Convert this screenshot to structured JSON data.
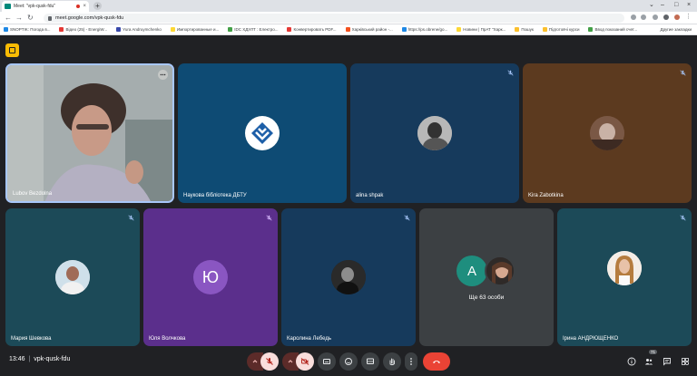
{
  "browser": {
    "tab_title": "Meet: \"vpk-qusk-fdu\"",
    "url": "meet.google.com/vpk-qusk-fdu",
    "bookmarks": [
      {
        "label": "SNOPTIK: Погода в...",
        "color": "#1e88e5"
      },
      {
        "label": "Відео (25) - EnergiW...",
        "color": "#e53935"
      },
      {
        "label": "Yura Andruymchenko",
        "color": "#3949ab"
      },
      {
        "label": "Импортированные и...",
        "color": "#fdd835"
      },
      {
        "label": "IDC ХДУЛТ : Електро...",
        "color": "#43a047"
      },
      {
        "label": "Конвертировать PDF...",
        "color": "#e53935"
      },
      {
        "label": "Харківський район -...",
        "color": "#f4511e"
      },
      {
        "label": "https://ps.obrene/go...",
        "color": "#1e88e5"
      },
      {
        "label": "Новини | ПрАТ \"Харк...",
        "color": "#fdd835"
      },
      {
        "label": "Пошук",
        "color": "#fbc02d"
      },
      {
        "label": "Підготовчі курси",
        "color": "#fbc02d"
      },
      {
        "label": "Ввод показаний счет...",
        "color": "#43a047"
      }
    ],
    "other_bookmarks": "Другие закладки"
  },
  "tiles": [
    {
      "name": "Lubov Bezdolna"
    },
    {
      "name": "Наукова бібліотека ДБТУ"
    },
    {
      "name": "alina shpak"
    },
    {
      "name": "Kira Zabotkina"
    },
    {
      "name": "Мария Шевкова"
    },
    {
      "name": "Юля Волчкова",
      "initial": "Ю"
    },
    {
      "name": "Каролина Лебедь"
    },
    {
      "name": "Ще 63 особи",
      "initial": "A"
    },
    {
      "name": "Ірина АНДРЮЩЕНКО"
    }
  ],
  "footer": {
    "time": "13:46",
    "separator": "|",
    "meeting_code": "vpk-qusk-fdu",
    "participant_count": "71"
  },
  "colors": {
    "end_call": "#ea4335",
    "muted_bg": "#f9dedc",
    "muted_icon": "#b3261e",
    "active_speaker_border": "#a8c7fa"
  }
}
